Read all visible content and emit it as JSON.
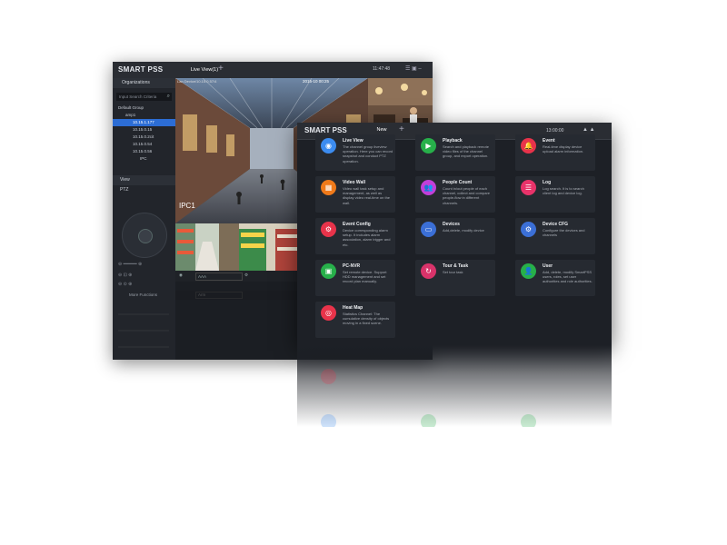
{
  "back_window": {
    "app_name": "SMART PSS",
    "tab": "Live View(1)",
    "clock": "11:47:48",
    "left_panel": {
      "header": "Organizations",
      "search_placeholder": "Input Search Criteria",
      "tree": [
        "Default Group",
        "amp1",
        "10.15.1.177",
        "10.15.0.15",
        "10.15.0.2cit",
        "10.15.0.54",
        "10.15.0.56",
        "IPC"
      ],
      "view_label": "View",
      "ptz_label": "PTZ",
      "more_functions": "More Functions"
    },
    "camera_overlay": "Lan Device/10.15.0.57/4",
    "camera_timestamp": "2015-10 00:25",
    "camera_label": "IPC1",
    "control_dropdown": "AAA",
    "control_dropdown2": "Arm"
  },
  "front_window": {
    "app_name": "SMART PSS",
    "tab": "New",
    "clock": "13:00:00",
    "tiles": [
      {
        "title": "Live View",
        "desc": "The channel group liveview operation. Here you can record snapshot and conduct PTZ operation.",
        "color": "#3c8cf0",
        "icon": "live-view-icon",
        "glyph": "◉"
      },
      {
        "title": "Playback",
        "desc": "Search and playback remote video files of the channel group, and export operation.",
        "color": "#27b04a",
        "icon": "playback-icon",
        "glyph": "▶"
      },
      {
        "title": "Event",
        "desc": "Real-time display device upload alarm information.",
        "color": "#e8334a",
        "icon": "event-icon",
        "glyph": "🔔"
      },
      {
        "title": "Video Wall",
        "desc": "Video wall task setup and management, as well as display video real-time on the wall.",
        "color": "#f07a1a",
        "icon": "video-wall-icon",
        "glyph": "▦"
      },
      {
        "title": "People Count",
        "desc": "Count in/out people of each channel, collect and compare people-flow in different channels.",
        "color": "#c23fd9",
        "icon": "people-count-icon",
        "glyph": "👥"
      },
      {
        "title": "Log",
        "desc": "Log search. It is to search client log and device log.",
        "color": "#e8336a",
        "icon": "log-icon",
        "glyph": "☰"
      },
      {
        "title": "Event Config",
        "desc": "Device corresponding alarm setup. It includes alarm association, alarm trigger and etc.",
        "color": "#e8334a",
        "icon": "event-config-icon",
        "glyph": "⚙"
      },
      {
        "title": "Devices",
        "desc": "Add,delete, modify device",
        "color": "#3b6fd6",
        "icon": "devices-icon",
        "glyph": "▭"
      },
      {
        "title": "Device CFG",
        "desc": "Configure the devices and channels",
        "color": "#3b6fd6",
        "icon": "device-cfg-icon",
        "glyph": "⚙"
      },
      {
        "title": "PC-NVR",
        "desc": "Set remote device. Support HDD management and set record plan manually.",
        "color": "#27b04a",
        "icon": "pc-nvr-icon",
        "glyph": "▣"
      },
      {
        "title": "Tour & Task",
        "desc": "Set tour task",
        "color": "#d9336a",
        "icon": "tour-task-icon",
        "glyph": "↻"
      },
      {
        "title": "User",
        "desc": "Add, delete, modify SmartPSS users, roles, set user authorities and role authorities.",
        "color": "#27b04a",
        "icon": "user-icon",
        "glyph": "👤"
      },
      {
        "title": "Heat Map",
        "desc": "Statistics Channel: The cumulative density of objects moving in a fixed scene.",
        "color": "#e8334a",
        "icon": "heat-map-icon",
        "glyph": "◎"
      }
    ]
  },
  "colors": {
    "accent": "#4a9cff",
    "selected_item": "#2c6dd5",
    "window_bg": "#1d2026",
    "tile_bg": "#262a31"
  }
}
